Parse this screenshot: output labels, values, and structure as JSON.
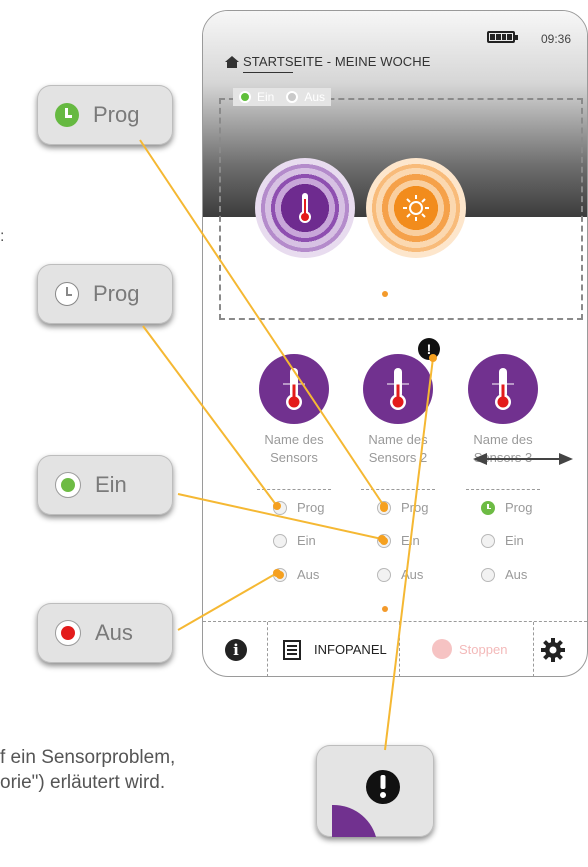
{
  "status_bar": {
    "time": "09:36"
  },
  "header": {
    "title": "STARTSEITE - MEINE WOCHE"
  },
  "mode_toggle": {
    "on_label": "Ein",
    "off_label": "Aus"
  },
  "sensors": [
    {
      "name_line1": "Name des",
      "name_line2": "Sensors",
      "options": {
        "prog": "Prog",
        "on": "Ein",
        "off": "Aus"
      }
    },
    {
      "name_line1": "Name des",
      "name_line2": "Sensors 2",
      "options": {
        "prog": "Prog",
        "on": "Ein",
        "off": "Aus"
      }
    },
    {
      "name_line1": "Name des",
      "name_line2": "Sensors 3",
      "options": {
        "prog": "Prog",
        "on": "Ein",
        "off": "Aus"
      }
    }
  ],
  "toolbar": {
    "infopanel_label": "INFOPANEL",
    "stop_label": "Stoppen"
  },
  "callouts": {
    "prog_active": "Prog",
    "prog_inactive": "Prog",
    "on": "Ein",
    "off": "Aus"
  },
  "caption": {
    "line1": "f ein Sensorproblem,",
    "line2": "orie\") erläutert wird."
  },
  "colors": {
    "accent_orange": "#f5a01f",
    "sensor_purple": "#71318f",
    "prog_green": "#6dbb44",
    "alarm_red": "#e31b1b"
  }
}
